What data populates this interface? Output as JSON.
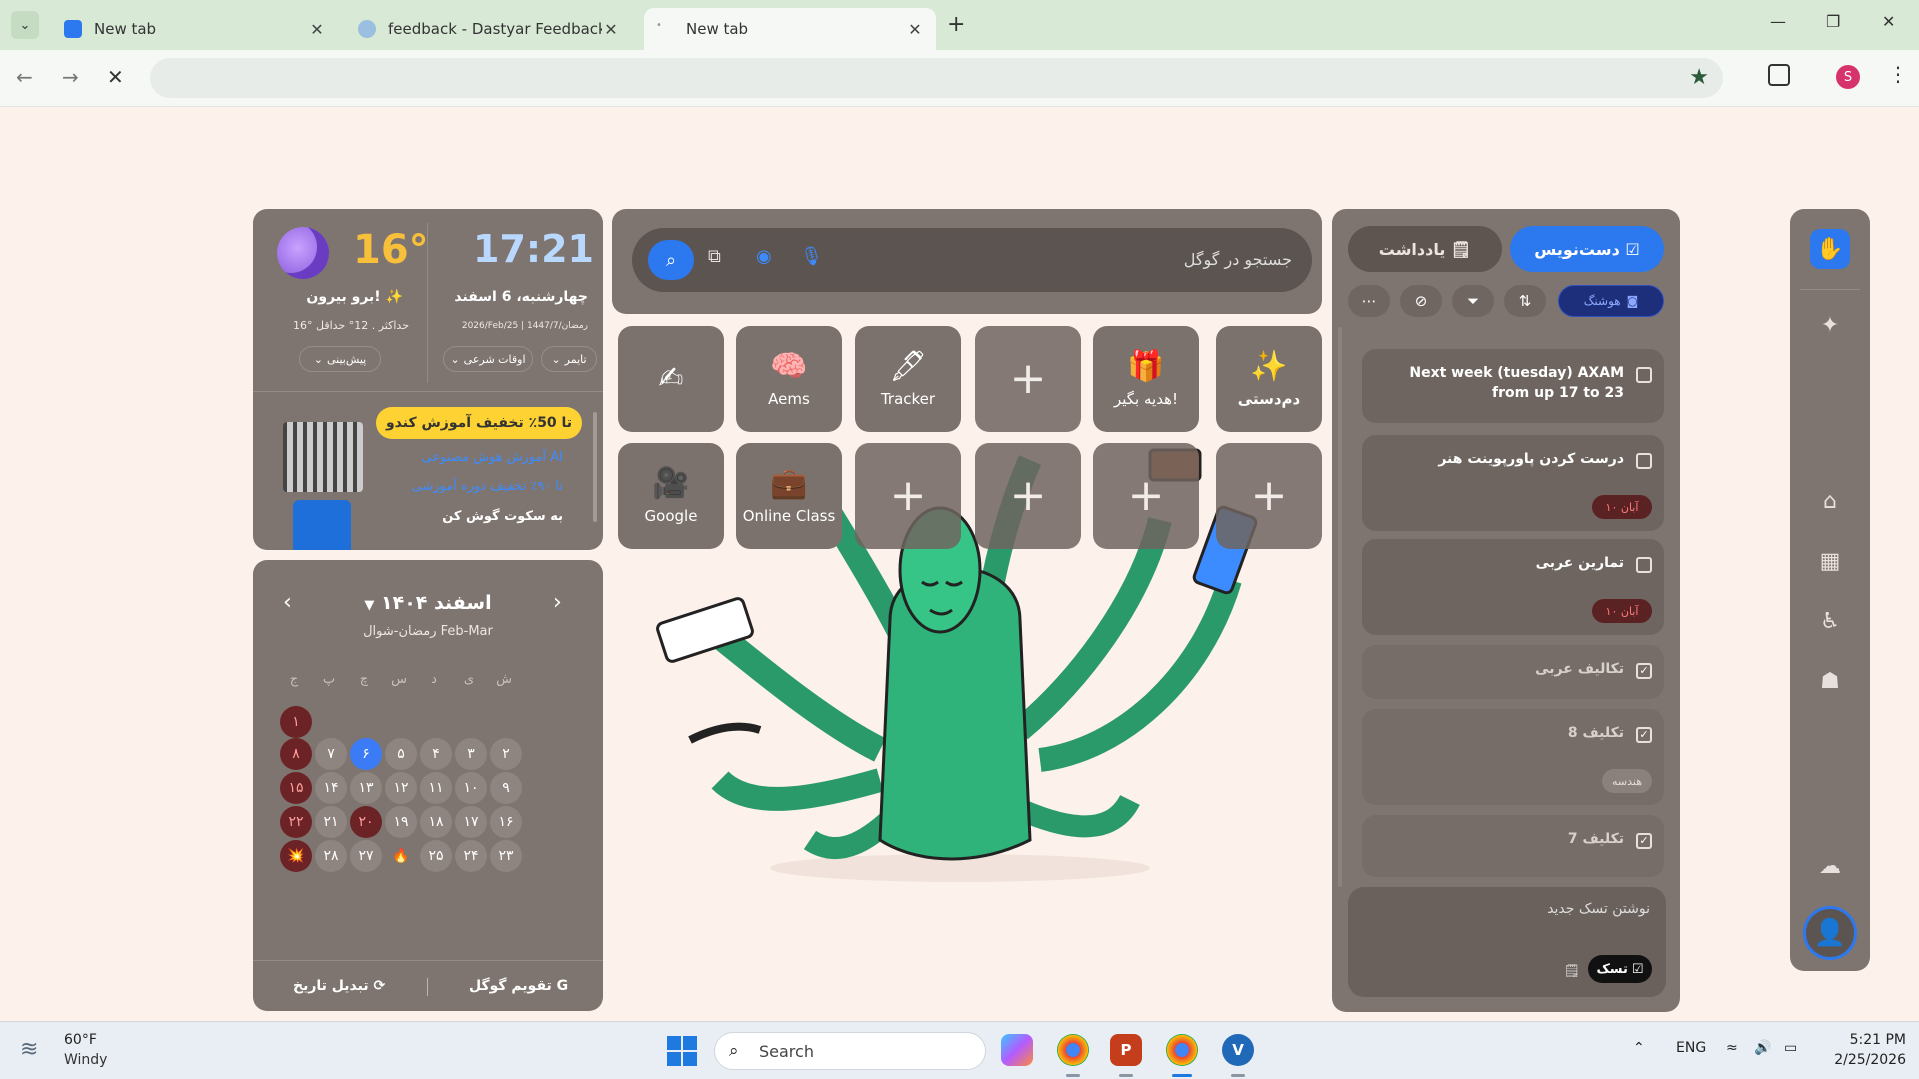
{
  "browser": {
    "tabs": [
      {
        "title": "New tab",
        "favicon_color": "#2c79ef"
      },
      {
        "title": "feedback - Dastyar Feedback C",
        "favicon_color": "#9bbfe0"
      },
      {
        "title": "New tab",
        "favicon_color": "#cfd8cf"
      }
    ],
    "active_tab": 2,
    "profile_initial": "S"
  },
  "weather": {
    "temp": "16°",
    "condition": "برو بیرون! ✨",
    "max": "16° حداکثر",
    "min": "12° حداقل",
    "forecast_label": "پیش‌بینی"
  },
  "clock": {
    "time": "17:21",
    "date_fa": "چهارشنبه، 6 اسفند",
    "date_other": "2026/Feb/25 | 1447/رمضان/7",
    "timer_label": "تایمر",
    "prayer_label": "اوقات شرعی"
  },
  "news": {
    "promo": "تا 50٪ تخفیف آموزش کندو",
    "item1": "آموزش هوش مصنوعی AI",
    "item2": "تا ۹۰٪ تخفیف دوره‌ آموزشی",
    "item3": "به سکوت گوش کن"
  },
  "calendar": {
    "month": "اسفند ۱۴۰۴",
    "sub": "رمضان-شوال  Feb-Mar",
    "weekdays": [
      "ش",
      "ی",
      "د",
      "س",
      "چ",
      "پ",
      "ج"
    ],
    "days": [
      {
        "d": "۱",
        "type": "holiday",
        "row": 0,
        "col": 6
      },
      {
        "d": "۲",
        "row": 1,
        "col": 0
      },
      {
        "d": "۳",
        "row": 1,
        "col": 1
      },
      {
        "d": "۴",
        "row": 1,
        "col": 2
      },
      {
        "d": "۵",
        "row": 1,
        "col": 3
      },
      {
        "d": "۶",
        "type": "today",
        "row": 1,
        "col": 4
      },
      {
        "d": "۷",
        "row": 1,
        "col": 5
      },
      {
        "d": "۸",
        "type": "holiday",
        "row": 1,
        "col": 6
      },
      {
        "d": "۹",
        "row": 2,
        "col": 0
      },
      {
        "d": "۱۰",
        "row": 2,
        "col": 1
      },
      {
        "d": "۱۱",
        "row": 2,
        "col": 2
      },
      {
        "d": "۱۲",
        "row": 2,
        "col": 3
      },
      {
        "d": "۱۳",
        "row": 2,
        "col": 4
      },
      {
        "d": "۱۴",
        "row": 2,
        "col": 5
      },
      {
        "d": "۱۵",
        "type": "holiday",
        "row": 2,
        "col": 6
      },
      {
        "d": "۱۶",
        "row": 3,
        "col": 0
      },
      {
        "d": "۱۷",
        "row": 3,
        "col": 1
      },
      {
        "d": "۱۸",
        "row": 3,
        "col": 2
      },
      {
        "d": "۱۹",
        "row": 3,
        "col": 3
      },
      {
        "d": "۲۰",
        "type": "holiday",
        "row": 3,
        "col": 4
      },
      {
        "d": "۲۱",
        "row": 3,
        "col": 5
      },
      {
        "d": "۲۲",
        "type": "holiday",
        "row": 3,
        "col": 6
      },
      {
        "d": "۲۳",
        "row": 4,
        "col": 0
      },
      {
        "d": "۲۴",
        "row": 4,
        "col": 1
      },
      {
        "d": "۲۵",
        "row": 4,
        "col": 2
      },
      {
        "d": "🔥",
        "type": "plain",
        "row": 4,
        "col": 3
      },
      {
        "d": "۲۷",
        "row": 4,
        "col": 4
      },
      {
        "d": "۲۸",
        "row": 4,
        "col": 5
      },
      {
        "d": "💥",
        "type": "holiday",
        "row": 4,
        "col": 6
      }
    ],
    "google_cal_label": "تقویم گوگل",
    "convert_label": "تبدیل تاریخ"
  },
  "search": {
    "placeholder": "جستجو در گوگل"
  },
  "shortcuts": [
    {
      "label": "دم‌دستی",
      "icon": "✨",
      "type": "app"
    },
    {
      "label": "هدیه بگیر!",
      "icon": "🎁",
      "type": "app"
    },
    {
      "label": "",
      "icon": "+",
      "type": "add"
    },
    {
      "label": "Tracker",
      "icon": "🖋",
      "type": "app"
    },
    {
      "label": "Aems",
      "icon": "🧠",
      "type": "app"
    },
    {
      "label": "",
      "icon": "✍",
      "type": "app"
    },
    {
      "label": "",
      "icon": "+",
      "type": "add"
    },
    {
      "label": "",
      "icon": "+",
      "type": "add"
    },
    {
      "label": "",
      "icon": "+",
      "type": "add"
    },
    {
      "label": "",
      "icon": "+",
      "type": "add"
    },
    {
      "label": "Online Class",
      "icon": "💼",
      "type": "app"
    },
    {
      "label": "Google",
      "icon": "🎥",
      "type": "app"
    }
  ],
  "tasks": {
    "tab_tasks": "دست‌نویس",
    "tab_notes": "یادداشت",
    "smart_label": "هوشنگ",
    "items": [
      {
        "text": "Next week (tuesday) AXAM from up 17 to 23",
        "done": false,
        "due": "",
        "tag": ""
      },
      {
        "text": "درست کردن پاورپوینت هنر",
        "done": false,
        "due": "۱۰ آبان",
        "tag": ""
      },
      {
        "text": "تمارین عربی",
        "done": false,
        "due": "۱۰ آبان",
        "tag": ""
      },
      {
        "text": "تکالیف عربی",
        "done": true,
        "due": "",
        "tag": ""
      },
      {
        "text": "تکلیف 8",
        "done": true,
        "due": "",
        "tag": "هندسه"
      },
      {
        "text": "تکلیف 7",
        "done": true,
        "due": "",
        "tag": ""
      }
    ],
    "new_task_placeholder": "نوشتن تسک جدید",
    "task_type_label": "تسک"
  },
  "taskbar": {
    "temp": "60°F",
    "condition": "Windy",
    "search_label": "Search",
    "lang": "ENG",
    "time": "5:21 PM",
    "date": "2/25/2026"
  }
}
